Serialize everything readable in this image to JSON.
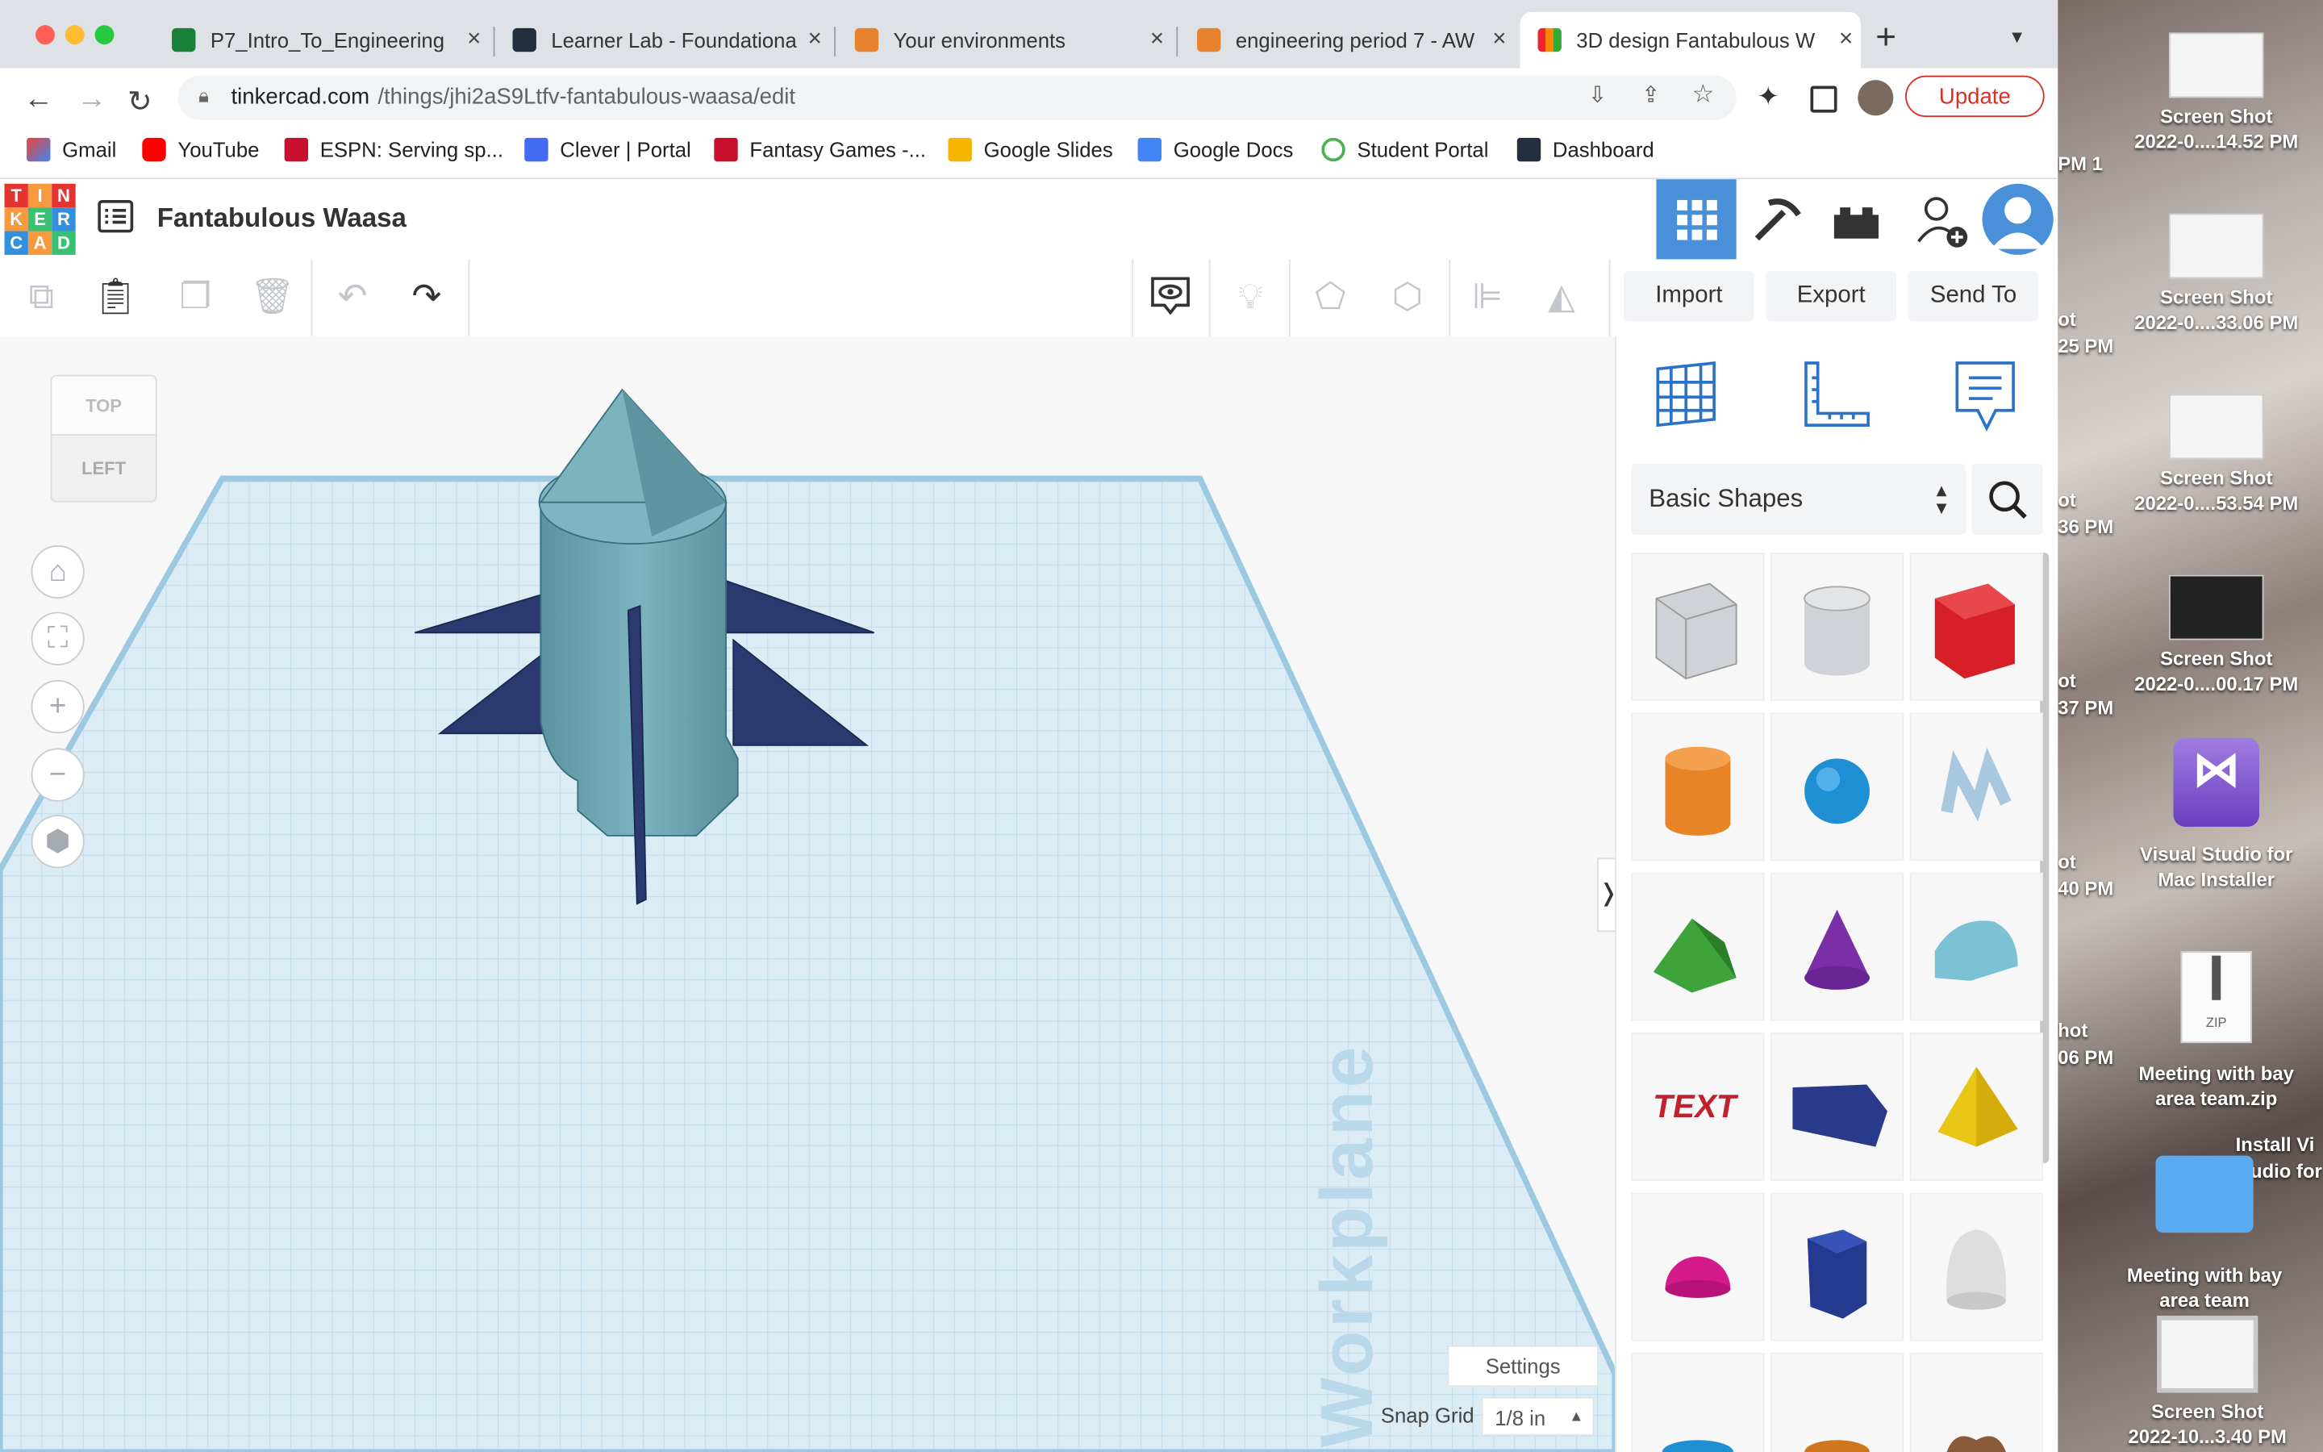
{
  "browser": {
    "tabs": [
      {
        "title": "P7_Intro_To_Engineering",
        "close": "×"
      },
      {
        "title": "Learner Lab - Foundationa",
        "close": "×"
      },
      {
        "title": "Your environments",
        "close": "×"
      },
      {
        "title": "engineering period 7 - AW",
        "close": "×"
      },
      {
        "title": "3D design Fantabulous W",
        "close": "×"
      }
    ],
    "new_tab": "+",
    "url_host": "tinkercad.com",
    "url_path": "/things/jhi2aS9Ltfv-fantabulous-waasa/edit",
    "update_label": "Update",
    "bookmarks": [
      "Gmail",
      "YouTube",
      "ESPN: Serving sp...",
      "Clever | Portal",
      "Fantasy Games -...",
      "Google Slides",
      "Google Docs",
      "Student Portal",
      "Dashboard"
    ]
  },
  "app": {
    "logo_letters": [
      "T",
      "I",
      "N",
      "K",
      "E",
      "R",
      "C",
      "A",
      "D"
    ],
    "design_name": "Fantabulous Waasa",
    "import_label": "Import",
    "export_label": "Export",
    "send_to_label": "Send To",
    "view_cube_top": "TOP",
    "view_cube_left": "LEFT",
    "workplane_label": "Workplane",
    "settings_label": "Settings",
    "snap_grid_label": "Snap Grid",
    "snap_grid_value": "1/8 in",
    "shape_library": "Basic Shapes",
    "shapes": [
      "box-hole",
      "cylinder-hole",
      "box",
      "cylinder",
      "sphere",
      "scribble",
      "roof",
      "cone",
      "round-roof",
      "text",
      "wedge",
      "pyramid",
      "half-sphere",
      "polygon",
      "paraboloid"
    ],
    "text_shape_label": "TEXT",
    "zip_label": "ZIP"
  },
  "desktop": {
    "icons": [
      {
        "l1": "Screen Shot",
        "l2": "2022-0....14.52 PM"
      },
      {
        "l1": "Screen Shot",
        "l2": "2022-0....33.06 PM"
      },
      {
        "l1": "Screen Shot",
        "l2": "2022-0....53.54 PM"
      },
      {
        "l1": "Screen Shot",
        "l2": "2022-0....00.17 PM"
      },
      {
        "l1": "Visual Studio for",
        "l2": "Mac Installer"
      },
      {
        "l1": "Meeting with bay",
        "l2": "area team.zip"
      },
      {
        "l1": "Meeting with bay",
        "l2": "area team"
      },
      {
        "l1": "Screen Shot",
        "l2": "2022-10...3.40 PM"
      }
    ],
    "left_texts": [
      "PM 1",
      "ot",
      "25 PM",
      "ot",
      "36 PM",
      "ot",
      "37 PM",
      "ot",
      "40 PM",
      "hot",
      "06 PM"
    ],
    "install_l1": "Install Vi",
    "install_l2": "udio for"
  },
  "colors": {
    "accent_blue": "#2b73c9",
    "update_red": "#d93025",
    "rocket_body": "#6aa5b3",
    "fins": "#2a3a6e"
  }
}
